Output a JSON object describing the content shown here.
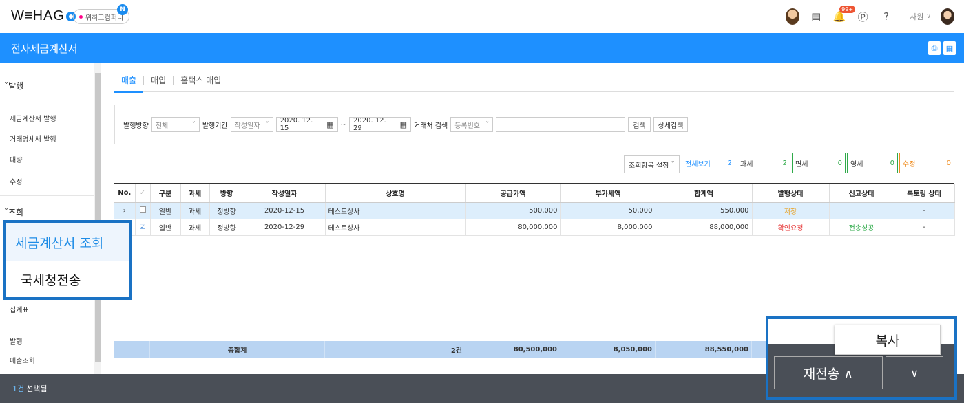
{
  "header": {
    "logo": "WEHAGO",
    "company": "위하고컴퍼니",
    "company_badge": "N",
    "notification_count": "99+",
    "user_name": "사원"
  },
  "titlebar": {
    "title": "전자세금계산서"
  },
  "sidebar": {
    "section_issue": "발행",
    "issue_items": [
      "세금계산서 발행",
      "거래명세서 발행",
      "대량",
      "수정"
    ],
    "section_view": "조회",
    "view_items_hidden_below": [
      "집계표",
      "발행",
      "매출조회"
    ]
  },
  "tabs": [
    "매출",
    "매입",
    "홈택스 매입"
  ],
  "filter": {
    "direction_label": "발행방향",
    "direction_value": "전체",
    "period_label": "발행기간",
    "period_type": "작성일자",
    "date_from": "2020. 12. 15",
    "date_to": "2020. 12. 29",
    "partner_label": "거래처 검색",
    "partner_type": "등록번호",
    "search_btn": "검색",
    "advanced_btn": "상세검색"
  },
  "summary": {
    "setting_label": "조회항목 설정",
    "chips": [
      {
        "label": "전체보기",
        "count": "2",
        "color": "#1e90ff"
      },
      {
        "label": "과세",
        "count": "2",
        "color": "#2faa4a"
      },
      {
        "label": "면세",
        "count": "0",
        "color": "#2faa4a"
      },
      {
        "label": "영세",
        "count": "0",
        "color": "#2faa4a"
      },
      {
        "label": "수정",
        "count": "0",
        "color": "#f08c1e"
      }
    ]
  },
  "grid": {
    "columns": [
      "No.",
      "✓",
      "구분",
      "과세",
      "방향",
      "작성일자",
      "상호명",
      "공급가액",
      "부가세액",
      "합계액",
      "발행상태",
      "신고상태",
      "록토링 상태"
    ],
    "rows": [
      {
        "no": "›",
        "checked": false,
        "type": "일반",
        "tax": "과세",
        "dir": "정방향",
        "date": "2020-12-15",
        "name": "테스트상사",
        "supply": "500,000",
        "vat": "50,000",
        "total": "550,000",
        "issue": "저장",
        "report": "",
        "status": "-"
      },
      {
        "no": "",
        "checked": true,
        "type": "일반",
        "tax": "과세",
        "dir": "정방향",
        "date": "2020-12-29",
        "name": "테스트상사",
        "supply": "80,000,000",
        "vat": "8,000,000",
        "total": "88,000,000",
        "issue": "확인요청",
        "report": "전송성공",
        "status": "-"
      }
    ],
    "total": {
      "label": "총합계",
      "count": "2건",
      "supply": "80,500,000",
      "vat": "8,050,000",
      "total": "88,550,000"
    }
  },
  "bottombar": {
    "count": "1건",
    "text": "선택됨"
  },
  "zoom_left": {
    "item1": "세금계산서 조회",
    "item2": "국세청전송"
  },
  "zoom_right": {
    "copy": "복사",
    "resend": "재전송 ∧",
    "dropdown": "∨"
  }
}
